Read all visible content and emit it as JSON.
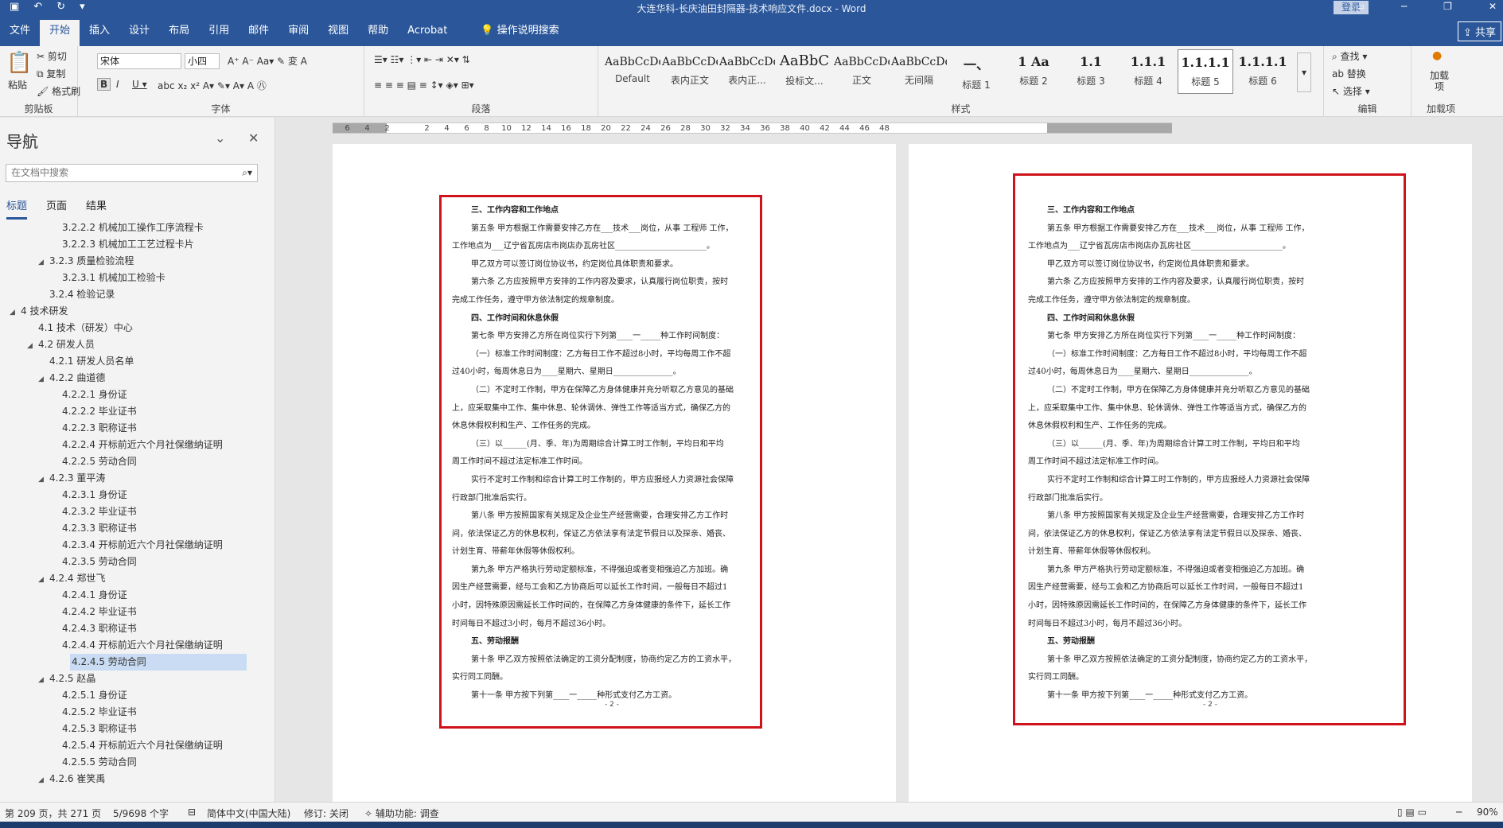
{
  "window": {
    "title": "大连华科-长庆油田封隔器-技术响应文件.docx - Word",
    "login_label": "登录",
    "share_label": "共享"
  },
  "menu": {
    "tabs": [
      "文件",
      "开始",
      "插入",
      "设计",
      "布局",
      "引用",
      "邮件",
      "审阅",
      "视图",
      "帮助",
      "Acrobat",
      "操作说明搜索"
    ],
    "active": "开始"
  },
  "ribbon": {
    "clipboard": {
      "paste": "粘贴",
      "cut": "剪切",
      "copy": "复制",
      "format_painter": "格式刷",
      "label": "剪贴板"
    },
    "font": {
      "family": "宋体",
      "size": "小四",
      "label": "字体"
    },
    "paragraph": {
      "label": "段落"
    },
    "styles": {
      "label": "样式",
      "items": [
        {
          "preview": "AaBbCcDd",
          "name": "Default"
        },
        {
          "preview": "AaBbCcDdE",
          "name": "表内正文"
        },
        {
          "preview": "AaBbCcDdE",
          "name": "表内正..."
        },
        {
          "preview": "AaBbC",
          "name": "投标文..."
        },
        {
          "preview": "AaBbCcDdE",
          "name": "正文"
        },
        {
          "preview": "AaBbCcDdE",
          "name": "无间隔"
        },
        {
          "preview": "一、",
          "name": "标题 1"
        },
        {
          "preview": "1  Aa",
          "name": "标题 2"
        },
        {
          "preview": "1.1",
          "name": "标题 3"
        },
        {
          "preview": "1.1.1",
          "name": "标题 4"
        },
        {
          "preview": "1.1.1.1",
          "name": "标题 5"
        },
        {
          "preview": "1.1.1.1",
          "name": "标题 6"
        }
      ],
      "selected": "标题 5"
    },
    "editing": {
      "find": "查找",
      "replace": "替换",
      "select": "选择",
      "label": "编辑"
    },
    "addins": {
      "load": "加载项",
      "label": "加载项"
    }
  },
  "nav": {
    "title": "导航",
    "search_placeholder": "在文档中搜索",
    "tabs": [
      "标题",
      "页面",
      "结果"
    ],
    "items": [
      {
        "text": "3.2.2.2 机械加工操作工序流程卡",
        "level": 4,
        "arrow": false
      },
      {
        "text": "3.2.2.3 机械加工工艺过程卡片",
        "level": 4,
        "arrow": false
      },
      {
        "text": "3.2.3 质量检验流程",
        "level": 3,
        "arrow": true
      },
      {
        "text": "3.2.3.1 机械加工检验卡",
        "level": 4,
        "arrow": false
      },
      {
        "text": "3.2.4 检验记录",
        "level": 3,
        "arrow": false
      },
      {
        "text": "4 技术研发",
        "level": 1,
        "arrow": true
      },
      {
        "text": "4.1 技术（研发）中心",
        "level": 2,
        "arrow": false
      },
      {
        "text": "4.2 研发人员",
        "level": 2,
        "arrow": true
      },
      {
        "text": "4.2.1 研发人员名单",
        "level": 3,
        "arrow": false
      },
      {
        "text": "4.2.2 曲道德",
        "level": 3,
        "arrow": true
      },
      {
        "text": "4.2.2.1 身份证",
        "level": 4,
        "arrow": false
      },
      {
        "text": "4.2.2.2 毕业证书",
        "level": 4,
        "arrow": false
      },
      {
        "text": "4.2.2.3 职称证书",
        "level": 4,
        "arrow": false
      },
      {
        "text": "4.2.2.4 开标前近六个月社保缴纳证明",
        "level": 4,
        "arrow": false
      },
      {
        "text": "4.2.2.5 劳动合同",
        "level": 4,
        "arrow": false
      },
      {
        "text": "4.2.3 董平涛",
        "level": 3,
        "arrow": true
      },
      {
        "text": "4.2.3.1 身份证",
        "level": 4,
        "arrow": false
      },
      {
        "text": "4.2.3.2 毕业证书",
        "level": 4,
        "arrow": false
      },
      {
        "text": "4.2.3.3 职称证书",
        "level": 4,
        "arrow": false
      },
      {
        "text": "4.2.3.4 开标前近六个月社保缴纳证明",
        "level": 4,
        "arrow": false
      },
      {
        "text": "4.2.3.5 劳动合同",
        "level": 4,
        "arrow": false
      },
      {
        "text": "4.2.4 郑世飞",
        "level": 3,
        "arrow": true
      },
      {
        "text": "4.2.4.1 身份证",
        "level": 4,
        "arrow": false
      },
      {
        "text": "4.2.4.2 毕业证书",
        "level": 4,
        "arrow": false
      },
      {
        "text": "4.2.4.3 职称证书",
        "level": 4,
        "arrow": false
      },
      {
        "text": "4.2.4.4 开标前近六个月社保缴纳证明",
        "level": 4,
        "arrow": false
      },
      {
        "text": "4.2.4.5 劳动合同",
        "level": 4,
        "arrow": false,
        "selected": true
      },
      {
        "text": "4.2.5 赵晶",
        "level": 3,
        "arrow": true
      },
      {
        "text": "4.2.5.1 身份证",
        "level": 4,
        "arrow": false
      },
      {
        "text": "4.2.5.2 毕业证书",
        "level": 4,
        "arrow": false
      },
      {
        "text": "4.2.5.3 职称证书",
        "level": 4,
        "arrow": false
      },
      {
        "text": "4.2.5.4 开标前近六个月社保缴纳证明",
        "level": 4,
        "arrow": false
      },
      {
        "text": "4.2.5.5 劳动合同",
        "level": 4,
        "arrow": false
      },
      {
        "text": "4.2.6 崔笑禹",
        "level": 3,
        "arrow": true
      }
    ]
  },
  "ruler": {
    "ticks": [
      "6",
      "4",
      "2",
      "",
      "2",
      "4",
      "6",
      "8",
      "10",
      "12",
      "14",
      "16",
      "18",
      "20",
      "22",
      "24",
      "26",
      "28",
      "30",
      "32",
      "34",
      "36",
      "38",
      "40",
      "42",
      "44",
      "46",
      "48"
    ]
  },
  "document": {
    "lines": [
      {
        "t": "三、工作内容和工作地点",
        "b": true,
        "ind": true
      },
      {
        "t": "第五条  甲方根据工作需要安排乙方在___技术___岗位，从事 工程师 工作，",
        "ind": true
      },
      {
        "t": "工作地点为___辽宁省瓦房店市岗店办瓦房社区_______________________。"
      },
      {
        "t": "甲乙双方可以签订岗位协议书，约定岗位具体职责和要求。",
        "ind": true
      },
      {
        "t": "第六条  乙方应按照甲方安排的工作内容及要求，认真履行岗位职责，按时",
        "ind": true
      },
      {
        "t": "完成工作任务，遵守甲方依法制定的规章制度。"
      },
      {
        "t": "四、工作时间和休息休假",
        "b": true,
        "ind": true
      },
      {
        "t": "第七条  甲方安排乙方所在岗位实行下列第____一_____种工作时间制度：",
        "ind": true
      },
      {
        "t": "（一）标准工作时间制度：乙方每日工作不超过8小时，平均每周工作不超",
        "ind": true
      },
      {
        "t": "过40小时，每周休息日为____星期六、星期日_______________。"
      },
      {
        "t": "（二）不定时工作制，甲方在保障乙方身体健康并充分听取乙方意见的基础",
        "ind": true
      },
      {
        "t": "上，应采取集中工作、集中休息、轮休调休、弹性工作等适当方式，确保乙方的"
      },
      {
        "t": "休息休假权利和生产、工作任务的完成。"
      },
      {
        "t": "（三）以______(月、季、年)为周期综合计算工时工作制，平均日和平均",
        "ind": true
      },
      {
        "t": "周工作时间不超过法定标准工作时间。"
      },
      {
        "t": "实行不定时工作制和综合计算工时工作制的，甲方应报经人力资源社会保障",
        "ind": true
      },
      {
        "t": "行政部门批准后实行。"
      },
      {
        "t": "第八条  甲方按照国家有关规定及企业生产经营需要，合理安排乙方工作时",
        "ind": true
      },
      {
        "t": "间，依法保证乙方的休息权利，保证乙方依法享有法定节假日以及探亲、婚丧、"
      },
      {
        "t": "计划生育、带薪年休假等休假权利。"
      },
      {
        "t": "第九条  甲方严格执行劳动定额标准，不得强迫或者变相强迫乙方加班。确",
        "ind": true
      },
      {
        "t": "因生产经营需要，经与工会和乙方协商后可以延长工作时间，一般每日不超过1"
      },
      {
        "t": "小时，因特殊原因需延长工作时间的，在保障乙方身体健康的条件下，延长工作"
      },
      {
        "t": "时间每日不超过3小时，每月不超过36小时。"
      },
      {
        "t": "五、劳动报酬",
        "b": true,
        "ind": true
      },
      {
        "t": "第十条  甲乙双方按照依法确定的工资分配制度，协商约定乙方的工资水平，",
        "ind": true
      },
      {
        "t": "实行同工同酬。"
      },
      {
        "t": "第十一条  甲方按下列第____一_____种形式支付乙方工资。",
        "ind": true
      }
    ],
    "page_number": "- 2 -"
  },
  "status": {
    "page": "第 209 页，共 271 页",
    "words": "5/9698 个字",
    "language": "简体中文(中国大陆)",
    "track": "修订: 关闭",
    "accessibility": "辅助功能: 调查",
    "zoom": "90%"
  }
}
